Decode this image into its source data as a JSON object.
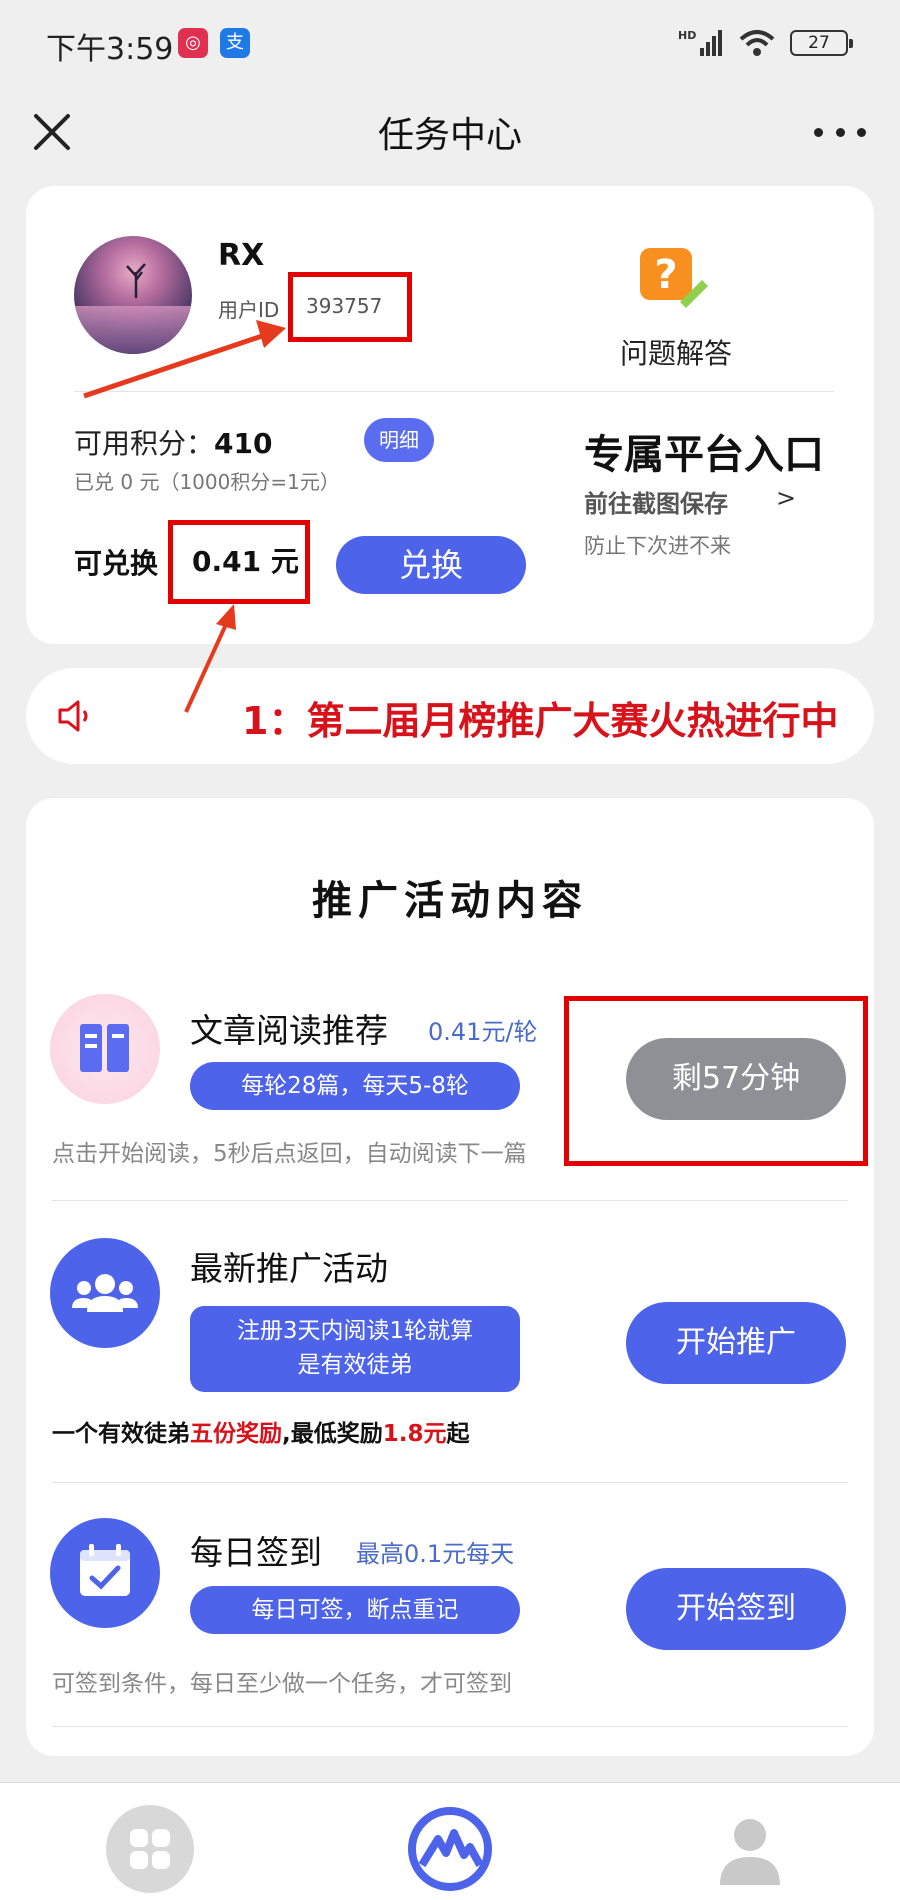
{
  "status_bar": {
    "time": "下午3:59",
    "network": "HD",
    "battery": "27"
  },
  "header": {
    "title": "任务中心"
  },
  "user": {
    "name": "RX",
    "id_label": "用户ID",
    "id_value": "393757",
    "help_label": "问题解答",
    "points_label": "可用积分：",
    "points_value": "410",
    "detail_button": "明细",
    "exchanged_note": "已兑 0 元（1000积分=1元）",
    "exchangeable_label": "可兑换",
    "exchangeable_value": "0.41 元",
    "exchange_button": "兑换"
  },
  "platform": {
    "title": "专属平台入口",
    "subtitle": "前往截图保存",
    "arrow": ">",
    "note": "防止下次进不来"
  },
  "announcement": {
    "text": "1：第二届月榜推广大赛火热进行中"
  },
  "activities": {
    "title": "推广活动内容",
    "items": [
      {
        "name": "文章阅读推荐",
        "rate": "0.41元/轮",
        "tag": "每轮28篇，每天5-8轮",
        "desc": "点击开始阅读，5秒后点返回，自动阅读下一篇",
        "button": "剩57分钟",
        "icon": "book-icon"
      },
      {
        "name": "最新推广活动",
        "tag_line1": "注册3天内阅读1轮就算",
        "tag_line2": "是有效徒弟",
        "button": "开始推广",
        "icon": "group-icon",
        "reward": {
          "part1": "一个有效徒弟",
          "part2": "五份奖励",
          "part3": ",最低奖励",
          "part4": "1.8元",
          "part5": "起"
        }
      },
      {
        "name": "每日签到",
        "rate": "最高0.1元每天",
        "tag": "每日可签，断点重记",
        "desc": "可签到条件，每日至少做一个任务，才可签到",
        "button": "开始签到",
        "icon": "calendar-icon"
      }
    ]
  },
  "colors": {
    "primary": "#4d63ea",
    "accent_red": "#d8121b",
    "disabled_button": "#8e9096"
  }
}
